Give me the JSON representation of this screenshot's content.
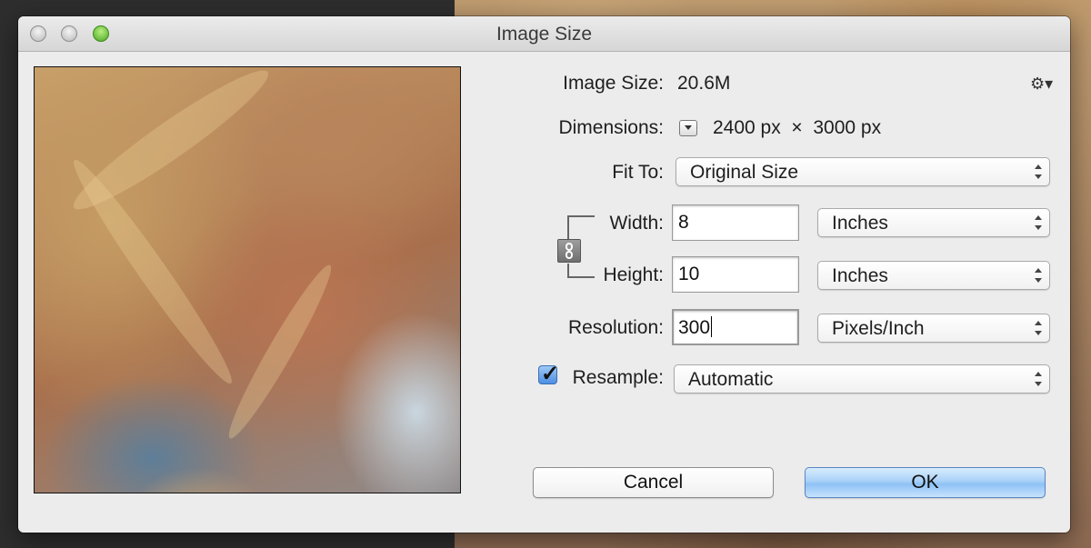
{
  "window": {
    "title": "Image Size"
  },
  "info": {
    "image_size_label": "Image Size:",
    "image_size_value": "20.6M",
    "dimensions_label": "Dimensions:",
    "dimensions_value": "2400 px  ×  3000 px"
  },
  "fit_to": {
    "label": "Fit To:",
    "value": "Original Size"
  },
  "width": {
    "label": "Width:",
    "value": "8",
    "unit": "Inches"
  },
  "height": {
    "label": "Height:",
    "value": "10",
    "unit": "Inches"
  },
  "resolution": {
    "label": "Resolution:",
    "value": "300",
    "unit": "Pixels/Inch"
  },
  "resample": {
    "label": "Resample:",
    "checked": true,
    "value": "Automatic"
  },
  "buttons": {
    "cancel": "Cancel",
    "ok": "OK"
  },
  "icons": {
    "gear": "gear-icon",
    "chain": "link-icon"
  }
}
